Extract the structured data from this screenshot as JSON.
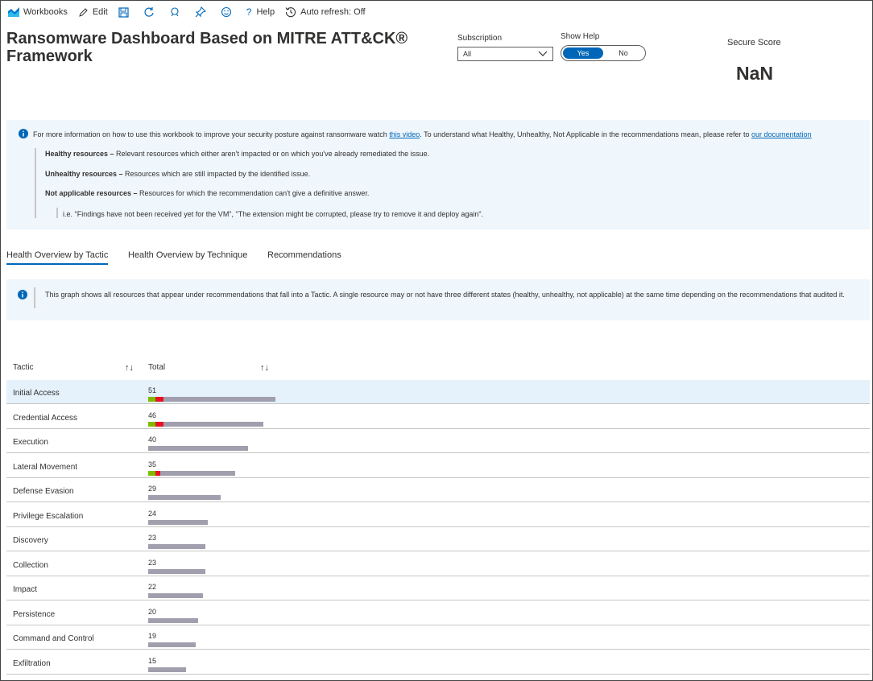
{
  "toolbar": {
    "workbooks": "Workbooks",
    "edit": "Edit",
    "help": "Help",
    "auto_refresh": "Auto refresh: Off"
  },
  "header": {
    "title": "Ransomware Dashboard Based on MITRE ATT&CK® Framework",
    "subscription_label": "Subscription",
    "subscription_value": "All",
    "show_help_label": "Show Help",
    "show_help_yes": "Yes",
    "show_help_no": "No",
    "secure_score_label": "Secure Score",
    "secure_score_value": "NaN"
  },
  "info": {
    "intro_prefix": "For more information on how to use this workbook to improve your security posture against ransomware watch ",
    "video_link": "this video",
    "intro_middle": ". To understand what Healthy, Unhealthy, Not Applicable in the recommendations mean, please refer to ",
    "docs_link": "our documentation",
    "healthy_term": "Healthy resources –",
    "healthy_desc": " Relevant resources which either aren't impacted or on which you've already remediated the issue.",
    "unhealthy_term": "Unhealthy resources –",
    "unhealthy_desc": " Resources which are still impacted by the identified issue.",
    "na_term": "Not applicable resources –",
    "na_desc": " Resources for which the recommendation can't give a definitive answer.",
    "example": "i.e. \"Findings have not been received yet for the VM\", \"The extension might be corrupted, please try to remove it and deploy again\"."
  },
  "tabs": [
    {
      "label": "Health Overview by Tactic"
    },
    {
      "label": "Health Overview by Technique"
    },
    {
      "label": "Recommendations"
    }
  ],
  "graph_info": "This graph shows all resources that appear under recommendations that fall into a Tactic. A single resource may or not have three different states (healthy, unhealthy, not applicable) at the same time depending on the recommendations that audited it.",
  "table": {
    "col_tactic": "Tactic",
    "col_total": "Total",
    "colors": {
      "healthy": "#7fba00",
      "unhealthy": "#e81123",
      "not_applicable": "#a19fad"
    },
    "rows": [
      {
        "tactic": "Initial Access",
        "total": "51",
        "healthy": 3,
        "unhealthy": 3,
        "na": 45
      },
      {
        "tactic": "Credential Access",
        "total": "46",
        "healthy": 3,
        "unhealthy": 3,
        "na": 40
      },
      {
        "tactic": "Execution",
        "total": "40",
        "healthy": 0,
        "unhealthy": 0,
        "na": 40
      },
      {
        "tactic": "Lateral Movement",
        "total": "35",
        "healthy": 3,
        "unhealthy": 2,
        "na": 30
      },
      {
        "tactic": "Defense Evasion",
        "total": "29",
        "healthy": 0,
        "unhealthy": 0,
        "na": 29
      },
      {
        "tactic": "Privilege Escalation",
        "total": "24",
        "healthy": 0,
        "unhealthy": 0,
        "na": 24
      },
      {
        "tactic": "Discovery",
        "total": "23",
        "healthy": 0,
        "unhealthy": 0,
        "na": 23
      },
      {
        "tactic": "Collection",
        "total": "23",
        "healthy": 0,
        "unhealthy": 0,
        "na": 23
      },
      {
        "tactic": "Impact",
        "total": "22",
        "healthy": 0,
        "unhealthy": 0,
        "na": 22
      },
      {
        "tactic": "Persistence",
        "total": "20",
        "healthy": 0,
        "unhealthy": 0,
        "na": 20
      },
      {
        "tactic": "Command and Control",
        "total": "19",
        "healthy": 0,
        "unhealthy": 0,
        "na": 19
      },
      {
        "tactic": "Exfiltration",
        "total": "15",
        "healthy": 0,
        "unhealthy": 0,
        "na": 15
      }
    ]
  }
}
